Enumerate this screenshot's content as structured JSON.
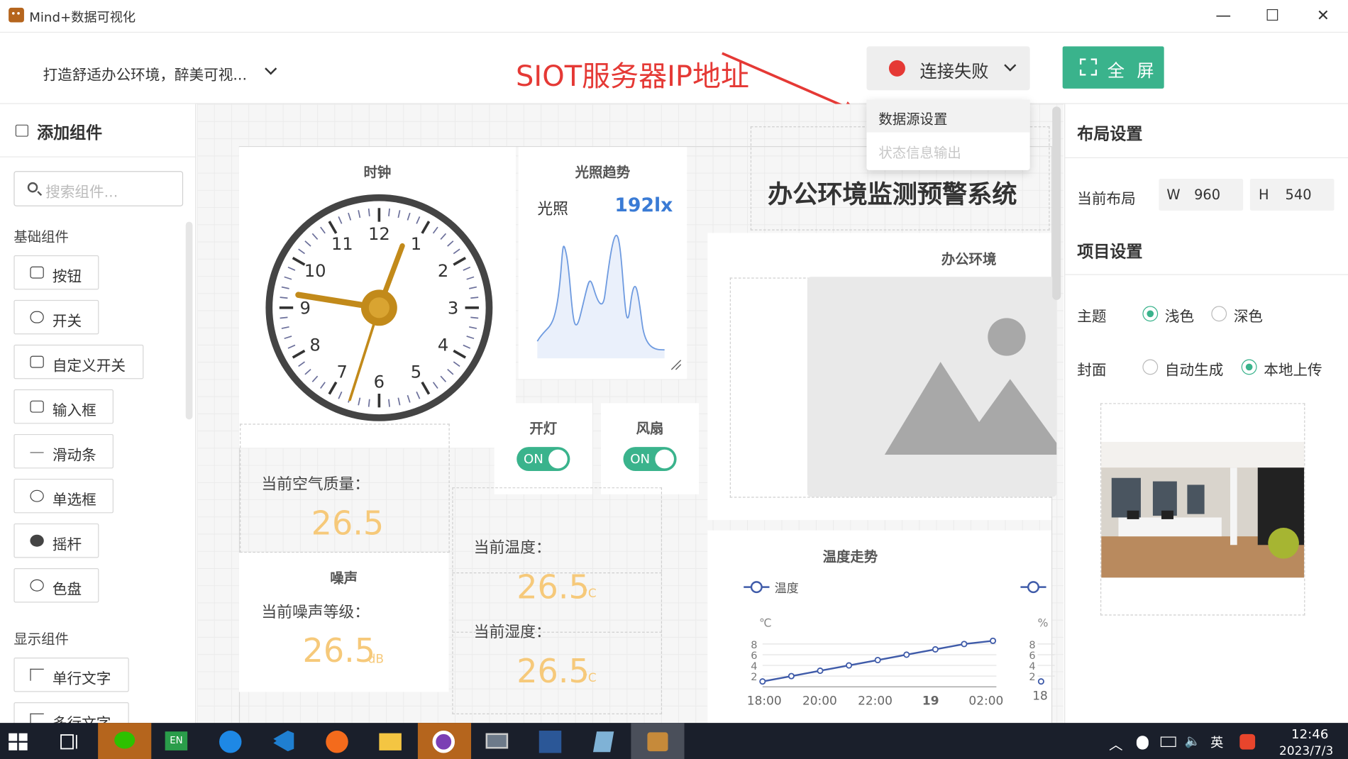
{
  "window": {
    "title": "Mind+数据可视化",
    "minimize": "—",
    "maximize": "☐",
    "close": "✕"
  },
  "toolbar": {
    "project_name": "打造舒适办公环境，醉美可视...",
    "connection_status": "连接失败",
    "fullscreen_label": "全 屏",
    "annotation": "SIOT服务器IP地址",
    "dropdown": [
      "数据源设置",
      "状态信息输出"
    ]
  },
  "left_panel": {
    "title": "添加组件",
    "search_placeholder": "搜索组件...",
    "basic_section": "基础组件",
    "basic_items": [
      "按钮",
      "开关",
      "自定义开关",
      "输入框",
      "滑动条",
      "单选框",
      "摇杆",
      "色盘"
    ],
    "display_section": "显示组件",
    "display_items": [
      "单行文字",
      "多行文字"
    ]
  },
  "canvas": {
    "clock": {
      "title": "时钟",
      "numbers": [
        "12",
        "1",
        "2",
        "3",
        "4",
        "5",
        "6",
        "7",
        "8",
        "9",
        "10",
        "11"
      ]
    },
    "light": {
      "title": "光照趋势",
      "label": "光照",
      "value": "192lx"
    },
    "switch_light": {
      "title": "开灯",
      "state": "ON"
    },
    "switch_fan": {
      "title": "风扇",
      "state": "ON"
    },
    "main_title": "办公环境监测预警系统",
    "office_image_title": "办公环境",
    "air": {
      "label": "当前空气质量：",
      "value": "26.5"
    },
    "noise": {
      "title": "噪声",
      "label": "当前噪声等级：",
      "value": "26.5",
      "unit": "dB"
    },
    "temp": {
      "label": "当前温度：",
      "value": "26.5",
      "unit": "°C"
    },
    "humidity": {
      "label": "当前湿度：",
      "value": "26.5",
      "unit": "°C"
    },
    "temp_trend": {
      "title": "温度走势",
      "legend": "温度",
      "y_unit": "℃",
      "y_unit2": "%",
      "x_labels": [
        "18:00",
        "20:00",
        "22:00",
        "19",
        "02:00"
      ],
      "y_ticks": [
        "8",
        "6",
        "4",
        "2"
      ],
      "y_ticks2": [
        "8",
        "6",
        "4",
        "2"
      ],
      "x_label2": "18"
    }
  },
  "right_panel": {
    "layout_title": "布局设置",
    "current_layout": "当前布局",
    "w_label": "W",
    "w_value": "960",
    "h_label": "H",
    "h_value": "540",
    "project_title": "项目设置",
    "theme_label": "主题",
    "theme_options": [
      "浅色",
      "深色"
    ],
    "cover_label": "封面",
    "cover_options": [
      "自动生成",
      "本地上传"
    ]
  },
  "taskbar": {
    "time": "12:46",
    "date": "2023/7/3",
    "ime": "英",
    "en_label": "EN"
  },
  "chart_data": {
    "type": "line",
    "title": "温度走势",
    "x": [
      "18:00",
      "20:00",
      "22:00",
      "19",
      "02:00"
    ],
    "series": [
      {
        "name": "温度",
        "values": [
          1,
          2,
          3,
          4,
          5,
          6,
          7,
          8,
          8.6
        ]
      }
    ],
    "ylim": [
      0,
      9
    ],
    "ylabel": "℃"
  }
}
